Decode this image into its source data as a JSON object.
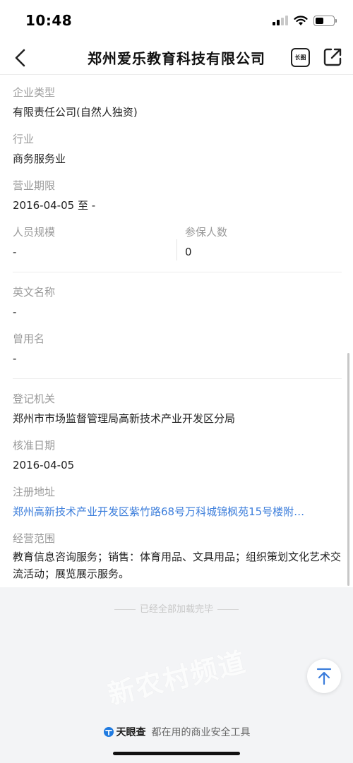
{
  "status_bar": {
    "time": "10:48"
  },
  "nav": {
    "title": "郑州爱乐教育科技有限公司",
    "long_image_label": "长图"
  },
  "fields": {
    "company_type": {
      "label": "企业类型",
      "value": "有限责任公司(自然人独资)"
    },
    "industry": {
      "label": "行业",
      "value": "商务服务业"
    },
    "business_term": {
      "label": "营业期限",
      "value": "2016-04-05 至 -"
    },
    "staff_size": {
      "label": "人员规模",
      "value": "-"
    },
    "insured_count": {
      "label": "参保人数",
      "value": "0"
    },
    "english_name": {
      "label": "英文名称",
      "value": "-"
    },
    "former_name": {
      "label": "曾用名",
      "value": "-"
    },
    "registration_authority": {
      "label": "登记机关",
      "value": "郑州市市场监督管理局高新技术产业开发区分局"
    },
    "approval_date": {
      "label": "核准日期",
      "value": "2016-04-05"
    },
    "registered_address": {
      "label": "注册地址",
      "value": "郑州高新技术产业开发区紫竹路68号万科城锦枫苑15号楼附…"
    },
    "business_scope": {
      "label": "经营范围",
      "value": "教育信息咨询服务；销售：体育用品、文具用品；组织策划文化艺术交流活动；展览展示服务。"
    }
  },
  "end_note": "已经全部加载完毕",
  "watermark": "新农村频道",
  "footer": {
    "brand": "天眼查",
    "slogan": "都在用的商业安全工具"
  }
}
